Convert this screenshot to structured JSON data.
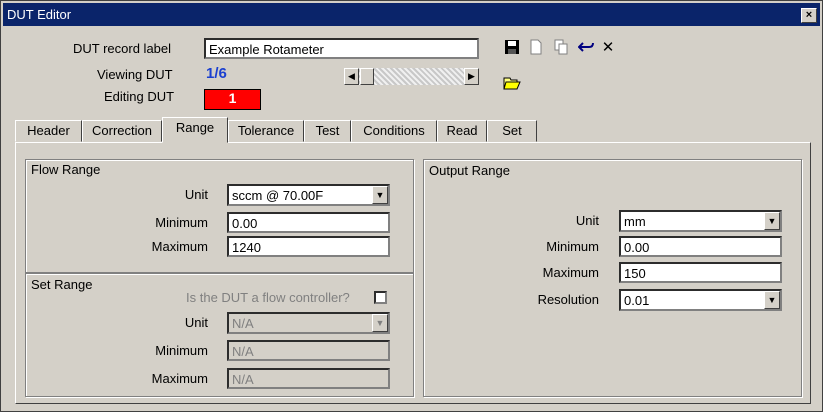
{
  "window": {
    "title": "DUT Editor",
    "close_glyph": "×"
  },
  "header": {
    "record_label": "DUT record label",
    "record_value": "Example Rotameter",
    "viewing_label": "Viewing DUT",
    "viewing_value": "1/6",
    "editing_label": "Editing DUT",
    "editing_value": "1"
  },
  "toolbar": {
    "icons": [
      "save-icon",
      "new-document-icon",
      "copy-icon",
      "undo-icon",
      "delete-icon",
      "open-folder-icon"
    ],
    "delete_glyph": "✕"
  },
  "tabs": [
    {
      "label": "Header"
    },
    {
      "label": "Correction"
    },
    {
      "label": "Range",
      "active": true
    },
    {
      "label": "Tolerance"
    },
    {
      "label": "Test"
    },
    {
      "label": "Conditions"
    },
    {
      "label": "Read"
    },
    {
      "label": "Set"
    }
  ],
  "flow_range": {
    "title": "Flow Range",
    "unit_label": "Unit",
    "unit_value": "sccm @ 70.00F",
    "min_label": "Minimum",
    "min_value": "0.00",
    "max_label": "Maximum",
    "max_value": "1240"
  },
  "set_range": {
    "title": "Set Range",
    "controller_question": "Is the DUT a flow controller?",
    "unit_label": "Unit",
    "unit_value": "N/A",
    "min_label": "Minimum",
    "min_value": "N/A",
    "max_label": "Maximum",
    "max_value": "N/A"
  },
  "output_range": {
    "title": "Output Range",
    "unit_label": "Unit",
    "unit_value": "mm",
    "min_label": "Minimum",
    "min_value": "0.00",
    "max_label": "Maximum",
    "max_value": "150",
    "res_label": "Resolution",
    "res_value": "0.01"
  },
  "colors": {
    "titlebar": "#0a246a",
    "editing_bg": "#ff0000",
    "viewing_text": "#1a3fd0"
  }
}
